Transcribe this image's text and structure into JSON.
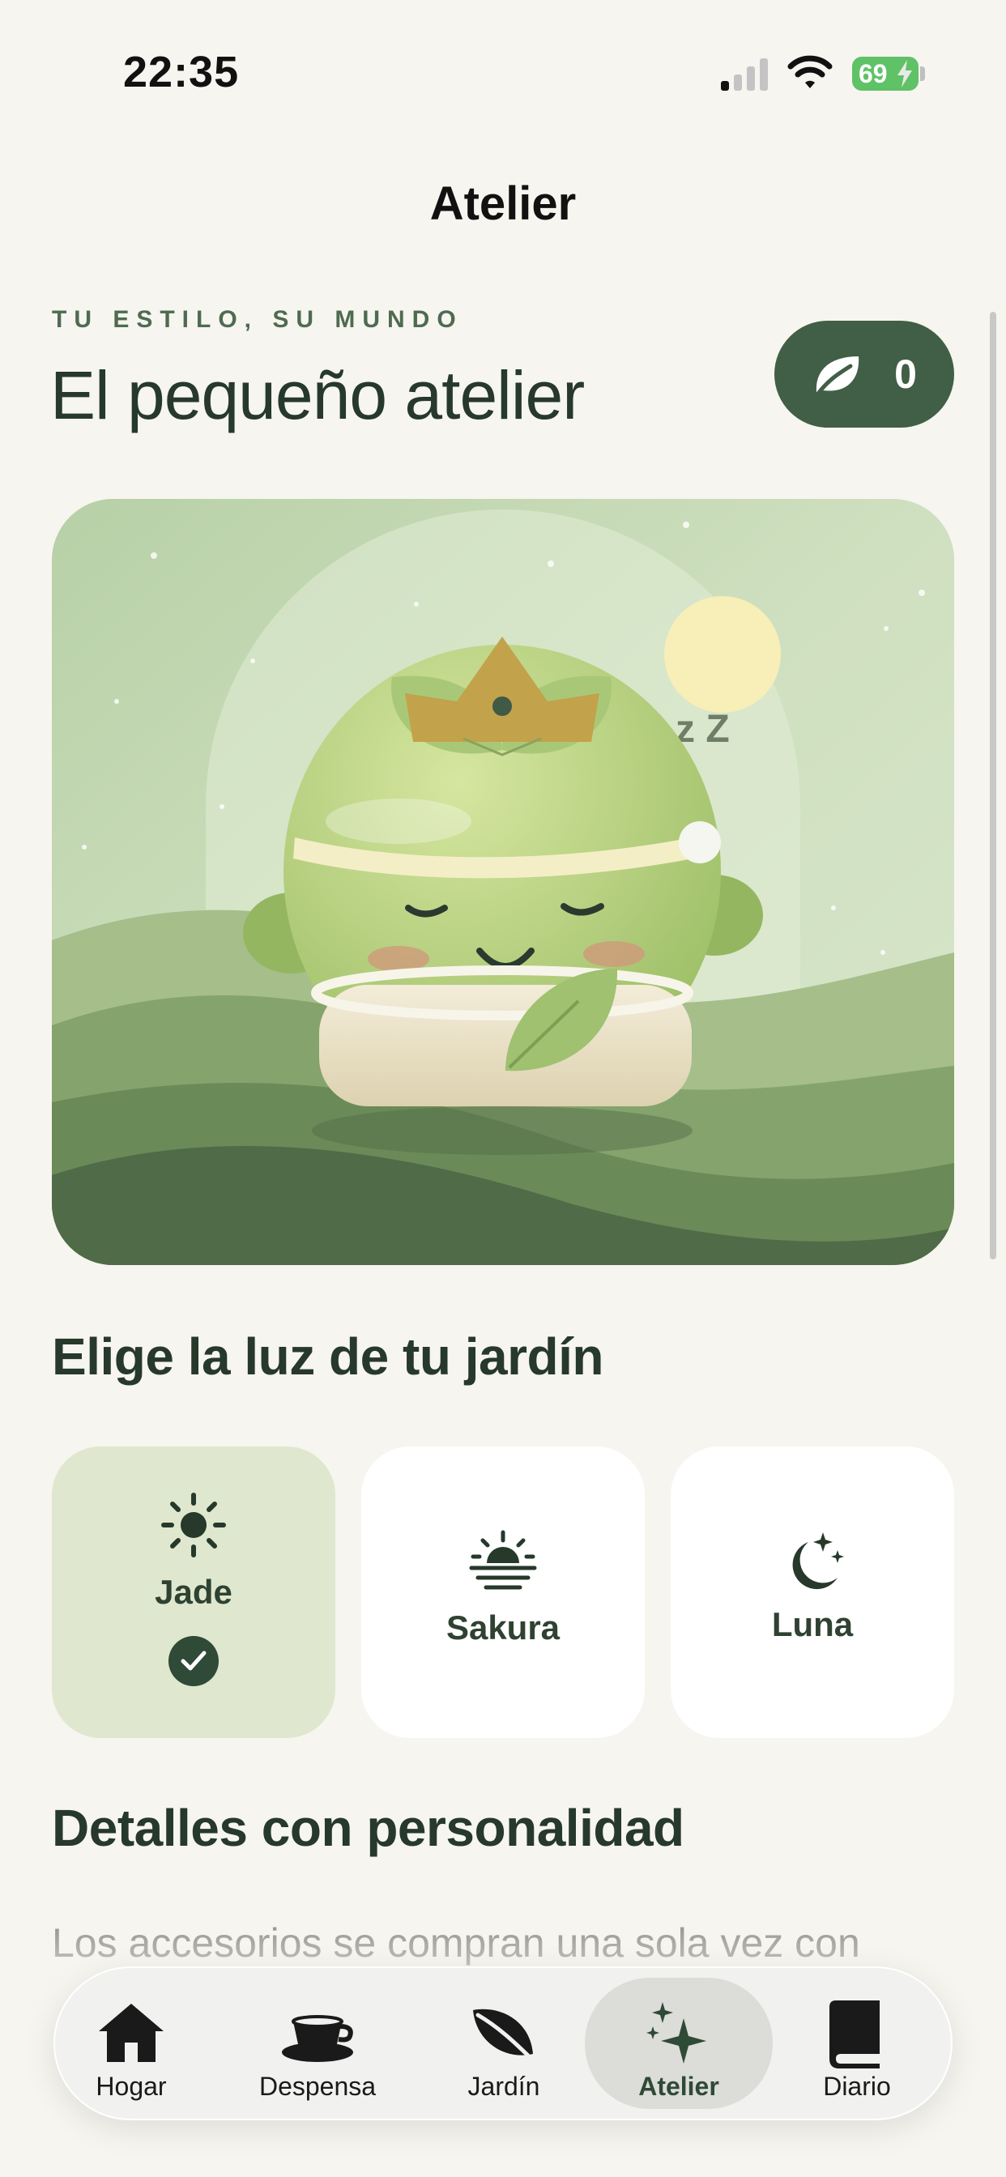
{
  "status_bar": {
    "time": "22:35",
    "battery": "69"
  },
  "nav": {
    "title": "Atelier"
  },
  "header": {
    "eyebrow": "TU ESTILO, SU MUNDO",
    "title": "El pequeño atelier",
    "leaf_count": "0"
  },
  "hero": {
    "sleep_text": "z Z"
  },
  "light_section": {
    "title": "Elige la luz de tu jardín",
    "options": [
      {
        "label": "Jade",
        "icon": "sun-icon",
        "selected": true
      },
      {
        "label": "Sakura",
        "icon": "sunset-icon",
        "selected": false
      },
      {
        "label": "Luna",
        "icon": "moon-stars-icon",
        "selected": false
      }
    ]
  },
  "accessories_section": {
    "title": "Detalles con personalidad",
    "body": "Los accesorios se compran una sola vez con"
  },
  "tabs": [
    {
      "label": "Hogar",
      "icon": "house-icon",
      "active": false
    },
    {
      "label": "Despensa",
      "icon": "cup-icon",
      "active": false
    },
    {
      "label": "Jardín",
      "icon": "leaf-icon",
      "active": false
    },
    {
      "label": "Atelier",
      "icon": "sparkles-icon",
      "active": true
    },
    {
      "label": "Diario",
      "icon": "book-icon",
      "active": false
    }
  ],
  "colors": {
    "background": "#f7f5ef",
    "primary_dark_green": "#415e47",
    "selected_card": "#dfe7cf",
    "battery_green": "#5fc266"
  }
}
